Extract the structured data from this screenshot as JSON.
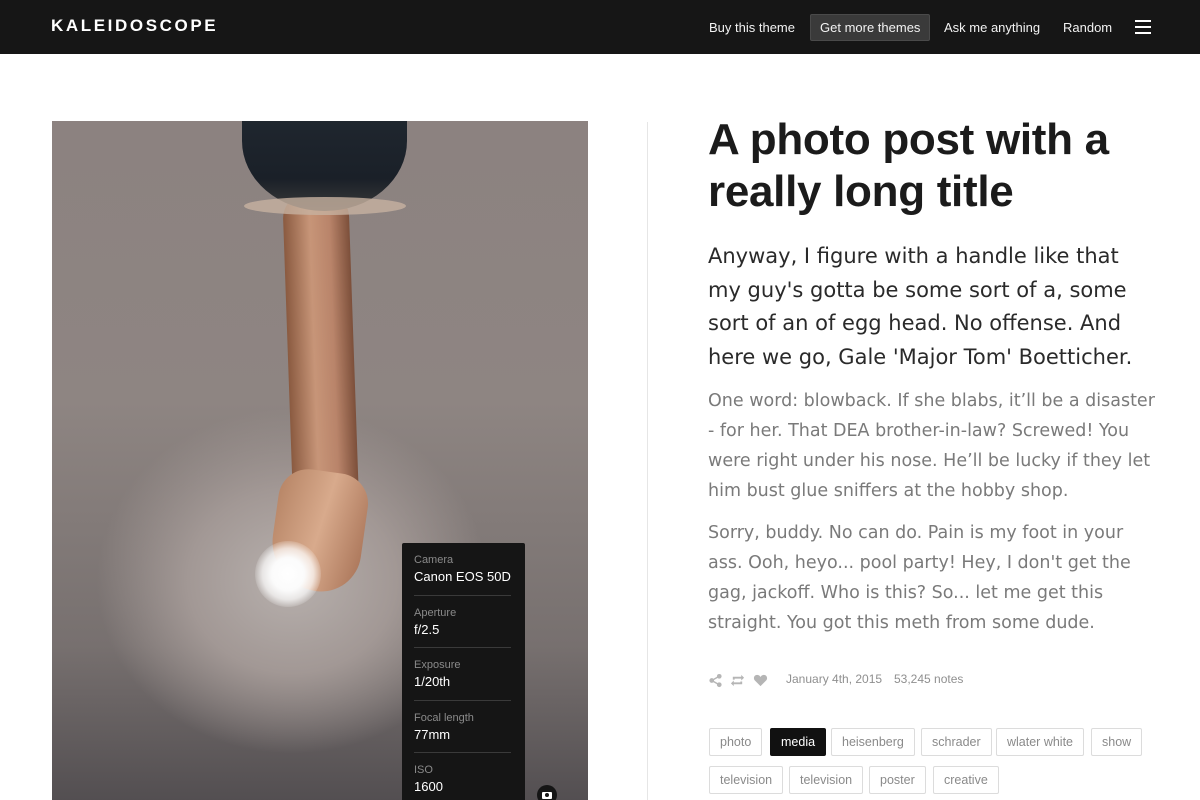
{
  "header": {
    "brand": "KALEIDOSCOPE",
    "nav": [
      "Buy this theme",
      "Get more themes",
      "Ask me anything",
      "Random"
    ]
  },
  "exif": [
    {
      "label": "Camera",
      "value": "Canon EOS 50D"
    },
    {
      "label": "Aperture",
      "value": "f/2.5"
    },
    {
      "label": "Exposure",
      "value": "1/20th"
    },
    {
      "label": "Focal length",
      "value": "77mm"
    },
    {
      "label": "ISO",
      "value": "1600"
    }
  ],
  "post": {
    "title": "A photo post with a really long title",
    "lead": "Anyway, I figure with a handle like that my guy's gotta be some sort of a, some sort of an of egg head. No offense. And here we go, Gale 'Major Tom' Boetticher.",
    "paragraphs": [
      "One word: blowback. If she blabs, it’ll be a disaster - for her. That DEA brother-in-law? Screwed! You were right under his nose. He’ll be lucky if they let him bust glue sniffers at the hobby shop.",
      "Sorry, buddy. No can do. Pain is my foot in your ass. Ooh, heyo... pool party! Hey, I don't get the gag, jackoff. Who is this? So... let me get this straight. You got this meth from some dude."
    ],
    "date": "January 4th, 2015",
    "notes": "53,245 notes",
    "tags": [
      "photo",
      "media",
      "heisenberg",
      "schrader",
      "wlater white",
      "show",
      "television",
      "television",
      "poster",
      "creative"
    ],
    "active_tag": "media"
  },
  "colors": {
    "topbar": "#161616",
    "tag_active": "#111111",
    "body_text": "#7a7a7a"
  }
}
